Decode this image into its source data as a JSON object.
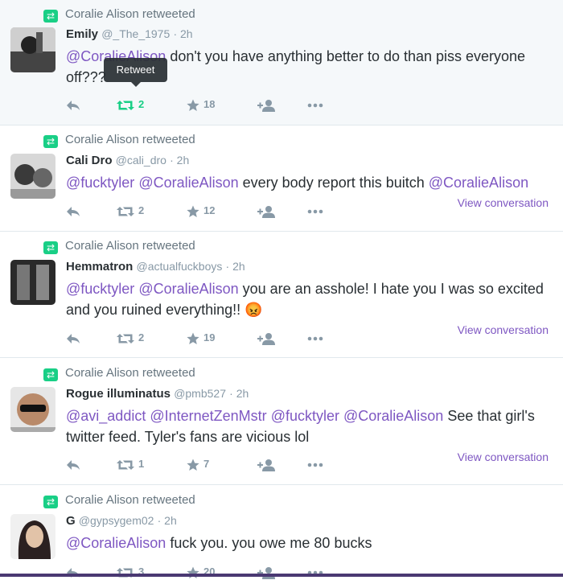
{
  "colors": {
    "mention": "#7e57c2",
    "retweet_green": "#19cf86",
    "muted": "#8899a6"
  },
  "tooltip": "Retweet",
  "tweets": [
    {
      "retweeted_by": "Coralie Alison retweeted",
      "name": "Emily",
      "handle": "@_The_1975",
      "time": "· 2h",
      "text": [
        {
          "t": "@CoralieAlison",
          "m": true
        },
        {
          "t": " don't you have anything better to do than piss everyone off???",
          "m": false
        }
      ],
      "retweets": "2",
      "likes": "18",
      "retweet_active": true,
      "view_conversation": ""
    },
    {
      "retweeted_by": "Coralie Alison retweeted",
      "name": "Cali Dro",
      "handle": "@cali_dro",
      "time": "· 2h",
      "text": [
        {
          "t": "@fucktyler",
          "m": true
        },
        {
          "t": " ",
          "m": false
        },
        {
          "t": "@CoralieAlison",
          "m": true
        },
        {
          "t": " every body report this buitch ",
          "m": false
        },
        {
          "t": "@CoralieAlison",
          "m": true
        }
      ],
      "retweets": "2",
      "likes": "12",
      "retweet_active": false,
      "view_conversation": "View conversation"
    },
    {
      "retweeted_by": "Coralie Alison retweeted",
      "name": "Hemmatron",
      "handle": "@actualfuckboys",
      "time": "· 2h",
      "text": [
        {
          "t": "@fucktyler",
          "m": true
        },
        {
          "t": " ",
          "m": false
        },
        {
          "t": "@CoralieAlison",
          "m": true
        },
        {
          "t": " you are an asshole! I hate you I was so excited and you ruined everything!! 😡",
          "m": false
        }
      ],
      "retweets": "2",
      "likes": "19",
      "retweet_active": false,
      "view_conversation": "View conversation"
    },
    {
      "retweeted_by": "Coralie Alison retweeted",
      "name": "Rogue illuminatus",
      "handle": "@pmb527",
      "time": "· 2h",
      "text": [
        {
          "t": "@avi_addict",
          "m": true
        },
        {
          "t": " ",
          "m": false
        },
        {
          "t": "@InternetZenMstr",
          "m": true
        },
        {
          "t": " ",
          "m": false
        },
        {
          "t": "@fucktyler",
          "m": true
        },
        {
          "t": " ",
          "m": false
        },
        {
          "t": "@CoralieAlison",
          "m": true
        },
        {
          "t": " See that girl's twitter feed. Tyler's fans are vicious lol",
          "m": false
        }
      ],
      "retweets": "1",
      "likes": "7",
      "retweet_active": false,
      "view_conversation": "View conversation"
    },
    {
      "retweeted_by": "Coralie Alison retweeted",
      "name": "G",
      "handle": "@gypsygem02",
      "time": "· 2h",
      "text": [
        {
          "t": "@CoralieAlison",
          "m": true
        },
        {
          "t": " fuck you. you owe me 80 bucks",
          "m": false
        }
      ],
      "retweets": "3",
      "likes": "20",
      "retweet_active": false,
      "view_conversation": ""
    }
  ]
}
